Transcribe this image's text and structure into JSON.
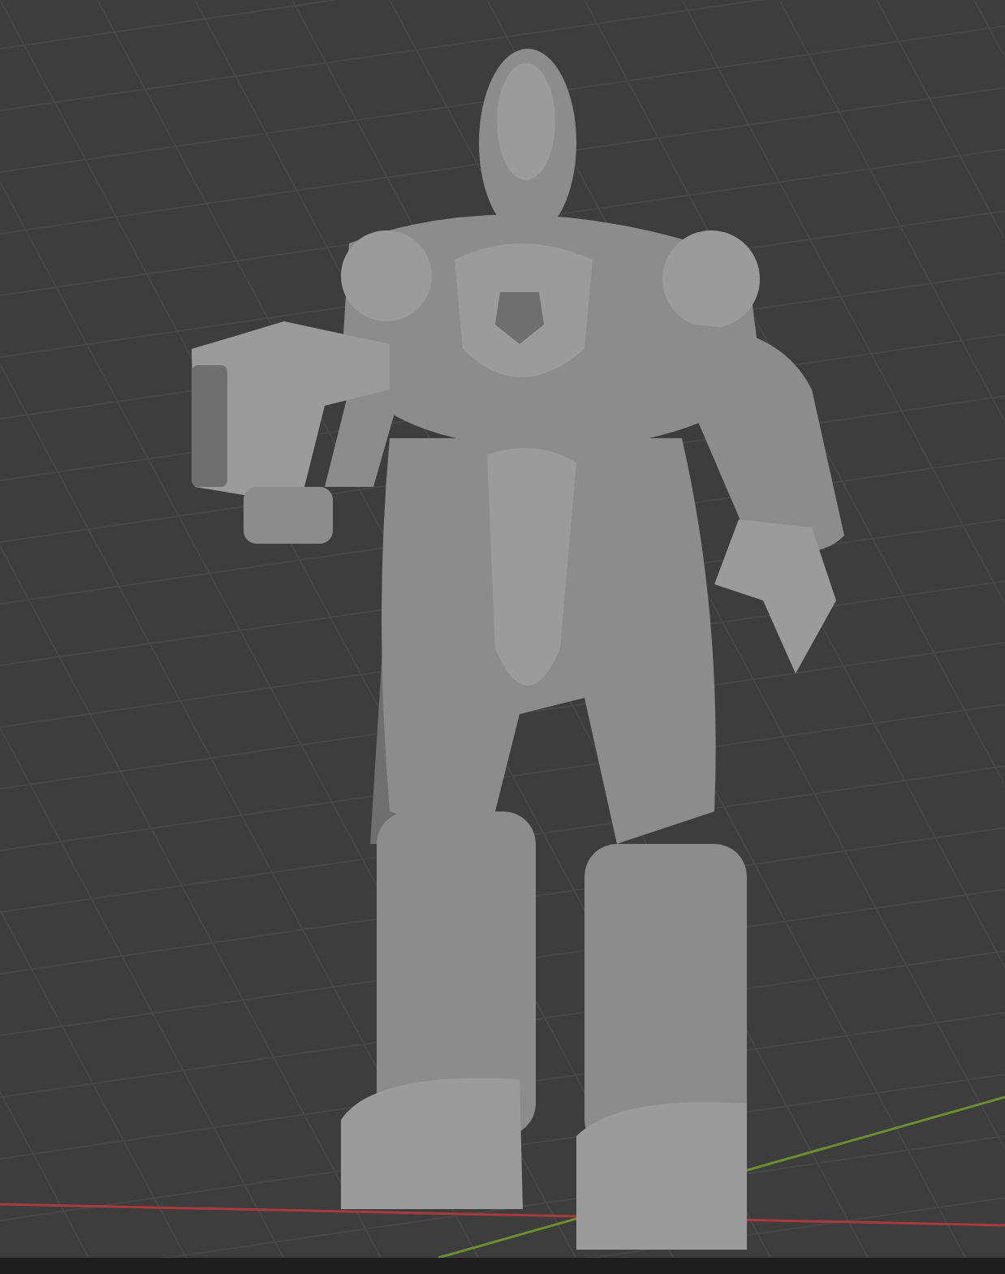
{
  "viewport": {
    "show_floor_grid": true,
    "show_axes": true
  }
}
